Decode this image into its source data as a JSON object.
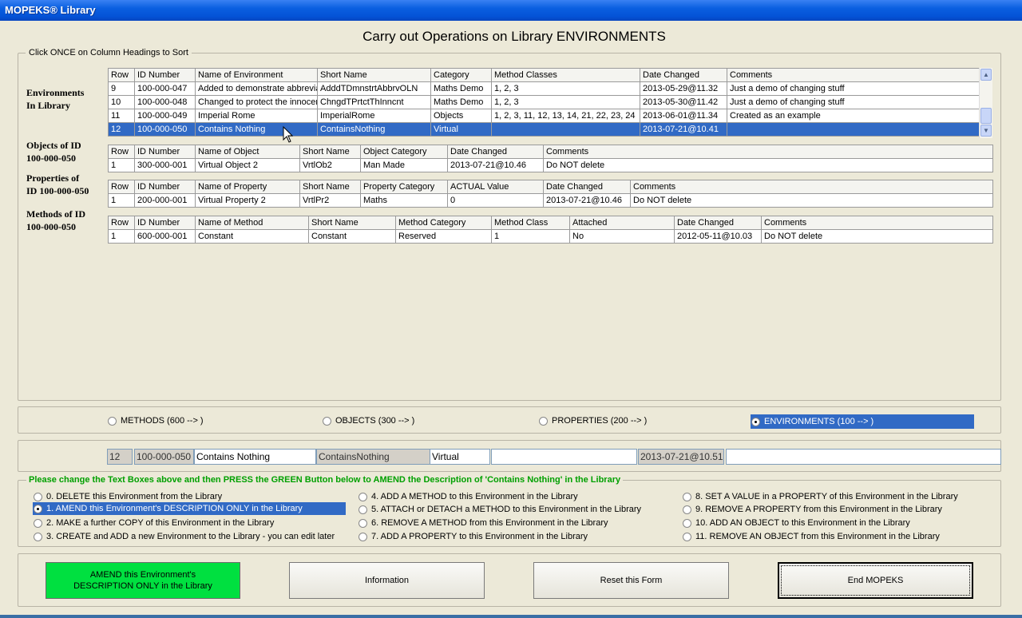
{
  "window": {
    "title": "MOPEKS® Library"
  },
  "page_heading": "Carry out Operations on Library ENVIRONMENTS",
  "sort_hint": "Click ONCE on Column Headings to Sort",
  "environments": {
    "label_1": "Environments",
    "label_2": "In Library",
    "columns": [
      "Row",
      "ID Number",
      "Name of Environment",
      "Short Name",
      "Category",
      "Method Classes",
      "Date Changed",
      "Comments"
    ],
    "rows": [
      [
        "9",
        "100-000-047",
        "Added to demonstrate abbreviations",
        "AdddTDmnstrtAbbrvOLN",
        "Maths Demo",
        "1, 2, 3",
        "2013-05-29@11.32",
        "Just a demo of changing stuff"
      ],
      [
        "10",
        "100-000-048",
        "Changed to protect the innocent",
        "ChngdTPrtctThInncnt",
        "Maths Demo",
        "1, 2, 3",
        "2013-05-30@11.42",
        "Just a demo of changing stuff"
      ],
      [
        "11",
        "100-000-049",
        "Imperial Rome",
        "ImperialRome",
        "Objects",
        "1, 2, 3, 11, 12, 13, 14, 21, 22, 23, 24",
        "2013-06-01@11.34",
        "Created as an example"
      ],
      [
        "12",
        "100-000-050",
        "Contains Nothing",
        "ContainsNothing",
        "Virtual",
        "",
        "2013-07-21@10.41",
        ""
      ]
    ]
  },
  "objects": {
    "label_1": "Objects of ID",
    "label_2": "100-000-050",
    "columns": [
      "Row",
      "ID Number",
      "Name of Object",
      "Short Name",
      "Object Category",
      "Date Changed",
      "Comments"
    ],
    "rows": [
      [
        "1",
        "300-000-001",
        "Virtual Object 2",
        "VrtlOb2",
        "Man Made",
        "2013-07-21@10.46",
        "Do NOT delete"
      ]
    ]
  },
  "properties": {
    "label_1": "Properties of",
    "label_2": "ID 100-000-050",
    "columns": [
      "Row",
      "ID Number",
      "Name of Property",
      "Short Name",
      "Property Category",
      "ACTUAL Value",
      "Date Changed",
      "Comments"
    ],
    "rows": [
      [
        "1",
        "200-000-001",
        "Virtual Property 2",
        "VrtlPr2",
        "Maths",
        "0",
        "2013-07-21@10.46",
        "Do NOT delete"
      ]
    ]
  },
  "methods": {
    "label_1": "Methods of ID",
    "label_2": "100-000-050",
    "columns": [
      "Row",
      "ID Number",
      "Name of Method",
      "Short Name",
      "Method Category",
      "Method Class",
      "Attached",
      "Date Changed",
      "Comments"
    ],
    "rows": [
      [
        "1",
        "600-000-001",
        "Constant",
        "Constant",
        "Reserved",
        "1",
        "No",
        "2012-05-11@10.03",
        "Do NOT delete"
      ]
    ]
  },
  "library_type": {
    "options": [
      "METHODS (600 --> )",
      "OBJECTS (300 --> )",
      "PROPERTIES (200 --> )",
      "ENVIRONMENTS (100 --> )"
    ],
    "selected": 3
  },
  "edit_fields": {
    "row": "12",
    "id_number": "100-000-050",
    "name": "Contains Nothing",
    "short_name": "ContainsNothing",
    "category": "Virtual",
    "method_classes": "",
    "date_changed": "2013-07-21@10.51",
    "comments": ""
  },
  "instruction": "Please change the Text Boxes above and then PRESS the GREEN Button below to AMEND the Description of 'Contains Nothing' in the Library",
  "operations": [
    "0. DELETE this Environment from the Library",
    "1. AMEND this Environment's DESCRIPTION ONLY in the Library",
    "2. MAKE a further COPY of this Environment in the Library",
    "3. CREATE and ADD a new Environment to the Library - you can edit later",
    "4. ADD A METHOD to this Environment in the Library",
    "5. ATTACH or DETACH a METHOD to this Environment in the Library",
    "6. REMOVE A METHOD from this Environment in the Library",
    "7. ADD A PROPERTY to this Environment in the Library",
    "8. SET A VALUE in a PROPERTY of this Environment in the Library",
    "9. REMOVE A PROPERTY from this Environment in the Library",
    "10. ADD AN OBJECT to this Environment in the Library",
    "11. REMOVE  AN OBJECT from this Environment in the Library"
  ],
  "selected_operation": 1,
  "buttons": {
    "amend_line1": "AMEND this Environment's",
    "amend_line2": "DESCRIPTION ONLY in the Library",
    "information": "Information",
    "reset": "Reset this Form",
    "end": "End MOPEKS"
  },
  "colors": {
    "selection": "#316AC5",
    "green_button": "#00E040",
    "instruction_text": "#00A000"
  }
}
